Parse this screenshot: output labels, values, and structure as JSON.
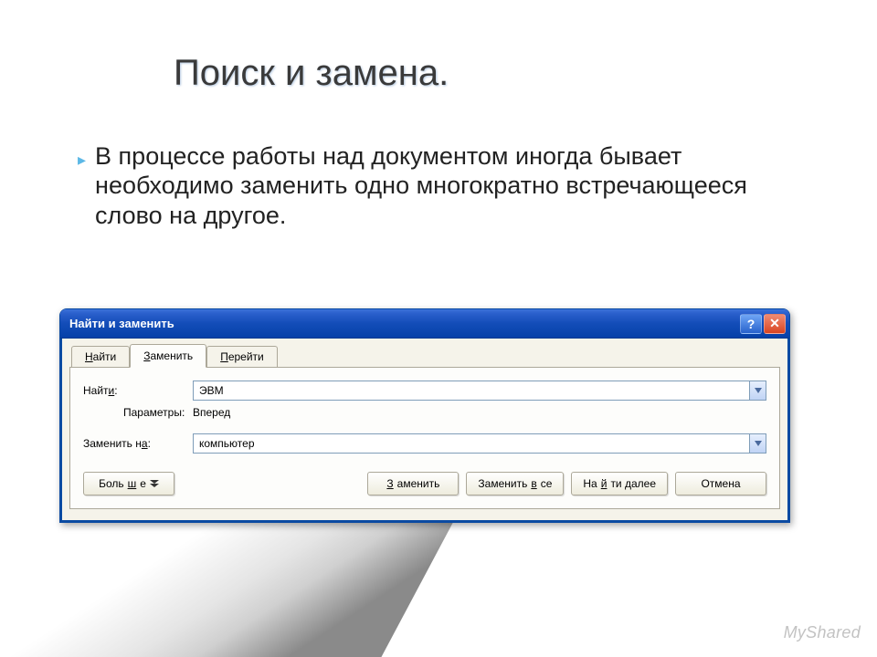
{
  "slide": {
    "title": "Поиск и замена.",
    "bullet_text": "В процессе работы над документом иногда бывает необходимо заменить одно многократно встречающееся слово на другое.",
    "watermark": "MyShared"
  },
  "dialog": {
    "title": "Найти и заменить",
    "help_icon": "?",
    "close_icon": "✕",
    "tabs": [
      {
        "accel": "Н",
        "rest": "айти",
        "active": false
      },
      {
        "accel": "З",
        "rest": "аменить",
        "active": true
      },
      {
        "accel": "П",
        "rest": "ерейти",
        "active": false
      }
    ],
    "find": {
      "label_pre": "Найт",
      "label_accel": "и",
      "label_post": ":",
      "value": "ЭВМ"
    },
    "options": {
      "label": "Параметры:",
      "value": "Вперед"
    },
    "replace": {
      "label_pre": "Заменить н",
      "label_accel": "а",
      "label_post": ":",
      "value": "компьютер"
    },
    "buttons": {
      "more_pre": "Боль",
      "more_accel": "ш",
      "more_post": "е",
      "replace_accel": "З",
      "replace_rest": "аменить",
      "replace_all_pre": "Заменить ",
      "replace_all_accel": "в",
      "replace_all_post": "се",
      "find_next_pre": "На",
      "find_next_accel": "й",
      "find_next_post": "ти далее",
      "cancel": "Отмена"
    }
  }
}
